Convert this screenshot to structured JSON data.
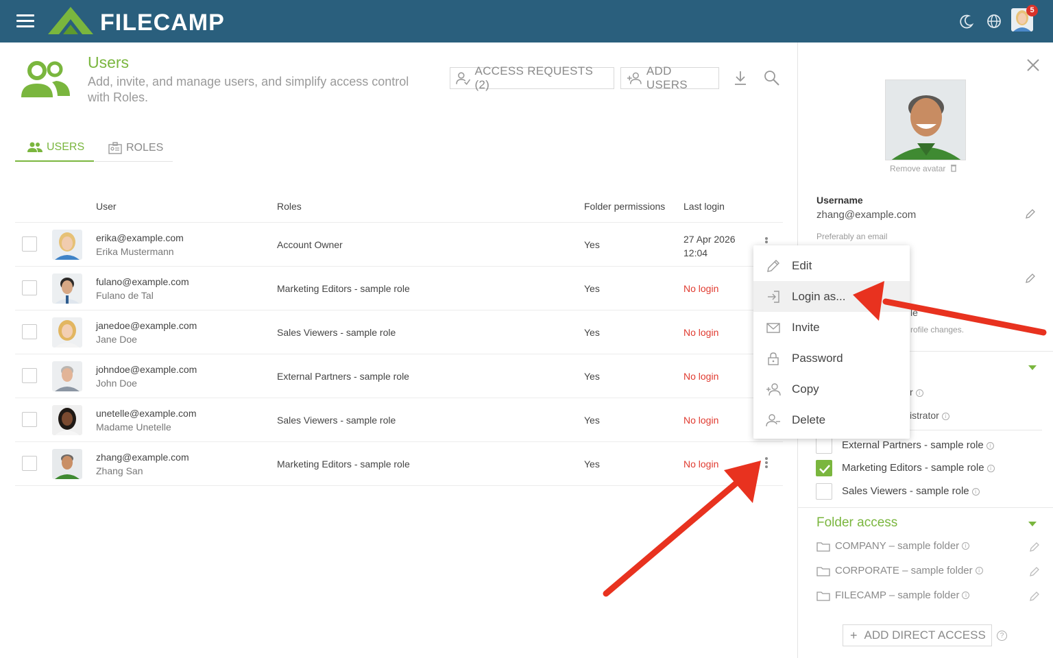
{
  "app": {
    "brand": "FILECAMP",
    "notification_count": "5"
  },
  "colors": {
    "topbar": "#2a5f7d",
    "accent_green": "#7ab63e",
    "danger_red": "#e03a2f",
    "annotation_red": "#e8321f"
  },
  "icons": {
    "menu": "hamburger-icon",
    "dark_mode": "moon-icon",
    "language": "globe-icon",
    "download": "download-icon",
    "search": "search-icon",
    "close": "close-icon"
  },
  "header": {
    "title": "Users",
    "subtitle": "Add, invite, and manage users, and simplify access control with Roles."
  },
  "toolbar": {
    "access_requests": "ACCESS REQUESTS (2)",
    "add_users": "ADD USERS"
  },
  "tabs": [
    {
      "label": "USERS",
      "active": true
    },
    {
      "label": "ROLES",
      "active": false
    }
  ],
  "table": {
    "headers": {
      "user": "User",
      "roles": "Roles",
      "folder_permissions": "Folder permissions",
      "last_login": "Last login"
    },
    "rows": [
      {
        "email": "erika@example.com",
        "name": "Erika Mustermann",
        "role": "Account Owner",
        "folder_permissions": "Yes",
        "last_login": "27 Apr 2026 12:04"
      },
      {
        "email": "fulano@example.com",
        "name": "Fulano de Tal",
        "role": "Marketing Editors - sample role",
        "folder_permissions": "Yes",
        "last_login": "No login"
      },
      {
        "email": "janedoe@example.com",
        "name": "Jane Doe",
        "role": "Sales Viewers - sample role",
        "folder_permissions": "Yes",
        "last_login": "No login"
      },
      {
        "email": "johndoe@example.com",
        "name": "John Doe",
        "role": "External Partners - sample role",
        "folder_permissions": "Yes",
        "last_login": "No login"
      },
      {
        "email": "unetelle@example.com",
        "name": "Madame Unetelle",
        "role": "Sales Viewers - sample role",
        "folder_permissions": "Yes",
        "last_login": "No login"
      },
      {
        "email": "zhang@example.com",
        "name": "Zhang San",
        "role": "Marketing Editors - sample role",
        "folder_permissions": "Yes",
        "last_login": "No login"
      }
    ]
  },
  "context_menu": {
    "items": [
      "Edit",
      "Login as...",
      "Invite",
      "Password",
      "Copy",
      "Delete"
    ],
    "highlighted": "Login as..."
  },
  "panel": {
    "remove_avatar": "Remove avatar",
    "username_label": "Username",
    "username_value": "zhang@example.com",
    "username_hint": "Preferably an email",
    "partial_le": "le",
    "partial_profile_changes": "rofile changes.",
    "partial_r": "r",
    "partial_istrator": "istrator",
    "roles": [
      {
        "label": "External Partners - sample role",
        "checked": false
      },
      {
        "label": "Marketing Editors - sample role",
        "checked": true
      },
      {
        "label": "Sales Viewers - sample role",
        "checked": false
      }
    ],
    "folder_access_title": "Folder access",
    "folders": [
      "COMPANY – sample folder",
      "CORPORATE – sample folder",
      "FILECAMP – sample folder"
    ],
    "add_direct_access": "ADD DIRECT ACCESS"
  }
}
